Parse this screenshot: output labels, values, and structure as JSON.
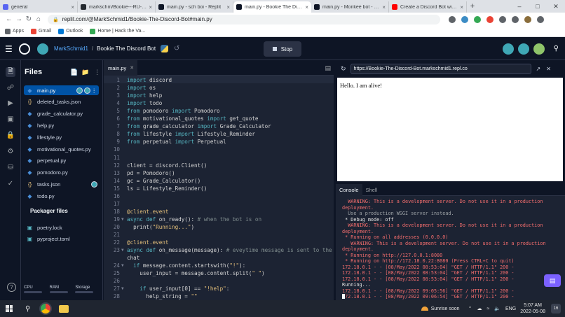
{
  "browser": {
    "tabs": [
      {
        "title": "general",
        "color": "#5865f2"
      },
      {
        "title": "markschm/Bookie---RU-Ha...",
        "color": "#24292f"
      },
      {
        "title": "main.py - sch boi - Replit",
        "color": "#0e1525"
      },
      {
        "title": "main.py - Bookie The Disco...",
        "color": "#0e1525"
      },
      {
        "title": "main.py - Monkee bot - Re...",
        "color": "#0e1525"
      },
      {
        "title": "Create a Discord Bot with Py...",
        "color": "#ff0000"
      }
    ],
    "active_tab": 3,
    "new_tab": "+",
    "url": "replit.com/@MarkSchmid1/Bookie-The-Discord-Bot#main.py",
    "bookmarks": [
      {
        "label": "Apps",
        "color": "#5f6368"
      },
      {
        "label": "Gmail",
        "color": "#ea4335"
      },
      {
        "label": "Outlook",
        "color": "#0078d4"
      },
      {
        "label": "Home | Hack the Va...",
        "color": "#34a853"
      }
    ]
  },
  "header": {
    "username": "MarkSchmid1",
    "separator": "/",
    "repl_name": "Bookie The Discord Bot",
    "stop_label": "Stop"
  },
  "files": {
    "title": "Files",
    "items": [
      {
        "name": "main.py",
        "icon": "python",
        "active": true
      },
      {
        "name": "deleted_tasks.json",
        "icon": "json"
      },
      {
        "name": "grade_calculator.py",
        "icon": "python"
      },
      {
        "name": "help.py",
        "icon": "python"
      },
      {
        "name": "lifestyle.py",
        "icon": "python"
      },
      {
        "name": "motivational_quotes.py",
        "icon": "python"
      },
      {
        "name": "perpetual.py",
        "icon": "python"
      },
      {
        "name": "pomodoro.py",
        "icon": "python"
      },
      {
        "name": "tasks.json",
        "icon": "json"
      },
      {
        "name": "todo.py",
        "icon": "python"
      }
    ],
    "packager_title": "Packager files",
    "packager_items": [
      {
        "name": "poetry.lock",
        "icon": "package"
      },
      {
        "name": "pyproject.toml",
        "icon": "package"
      }
    ],
    "resources": [
      "CPU",
      "RAM",
      "Storage"
    ]
  },
  "editor": {
    "tab": "main.py",
    "lines": [
      {
        "n": "1",
        "code": "import discord"
      },
      {
        "n": "2",
        "code": "import os"
      },
      {
        "n": "3",
        "code": "import help"
      },
      {
        "n": "4",
        "code": "import todo"
      },
      {
        "n": "5",
        "code": "from pomodoro import Pomodoro"
      },
      {
        "n": "6",
        "code": "from motivational_quotes import get_quote"
      },
      {
        "n": "7",
        "code": "from grade_calculator import Grade_Calculator"
      },
      {
        "n": "8",
        "code": "from lifestyle import Lifestyle_Reminder"
      },
      {
        "n": "9",
        "code": "from perpetual import Perpetual"
      },
      {
        "n": "10",
        "code": ""
      },
      {
        "n": "11",
        "code": ""
      },
      {
        "n": "12",
        "code": "client = discord.Client()"
      },
      {
        "n": "13",
        "code": "pd = Pomodoro()"
      },
      {
        "n": "14",
        "code": "gc = Grade_Calculator()"
      },
      {
        "n": "15",
        "code": "ls = Lifestyle_Reminder()"
      },
      {
        "n": "16",
        "code": ""
      },
      {
        "n": "17",
        "code": ""
      },
      {
        "n": "18",
        "code": "@client.event"
      },
      {
        "n": "19",
        "code": "async def on_ready(): # when the bot is on",
        "fold": true
      },
      {
        "n": "20",
        "code": "  print(\"Running...\")"
      },
      {
        "n": "21",
        "code": ""
      },
      {
        "n": "22",
        "code": "@client.event"
      },
      {
        "n": "23",
        "code": "async def on_message(message): # eveytime message is sent to the",
        "fold": true
      },
      {
        "n": "",
        "code": "chat"
      },
      {
        "n": "24",
        "code": "  if message.content.startswith(\"!\"):",
        "fold": true
      },
      {
        "n": "25",
        "code": "    user_input = message.content.split(\" \")"
      },
      {
        "n": "26",
        "code": ""
      },
      {
        "n": "27",
        "code": "    if user_input[0] == \"!help\":",
        "fold": true
      },
      {
        "n": "28",
        "code": "      help_string = \"\""
      }
    ]
  },
  "webview": {
    "url": "https://Bookie-The-Discord-Bot.markschmid1.repl.co",
    "content": "Hello. I am alive!"
  },
  "console": {
    "tabs": [
      "Console",
      "Shell"
    ],
    "lines": [
      {
        "t": "  WARNING: This is a development server. Do not use it in a production deployment.",
        "c": "cr"
      },
      {
        "t": "  Use a production WSGI server instead.",
        "c": "cg"
      },
      {
        "t": " * Debug mode: off",
        "c": "cw"
      },
      {
        "t": "  WARNING: This is a development server. Do not use it in a production deployment.",
        "c": "cr"
      },
      {
        "t": " * Running on all addresses (0.0.0.0)",
        "c": "cr"
      },
      {
        "t": "   WARNING: This is a development server. Do not use it in a production deployment.",
        "c": "cr"
      },
      {
        "t": " * Running on http://127.0.0.1:8080",
        "c": "cr"
      },
      {
        "t": " * Running on http://172.18.0.22:8080 (Press CTRL+C to quit)",
        "c": "cr"
      },
      {
        "t": "172.18.0.1 - - [08/May/2022 08:53:04] \"GET / HTTP/1.1\" 200 -",
        "c": "cr"
      },
      {
        "t": "172.18.0.1 - - [08/May/2022 08:53:04] \"GET / HTTP/1.1\" 200 -",
        "c": "cr"
      },
      {
        "t": "172.18.0.1 - - [08/May/2022 08:53:04] \"GET / HTTP/1.1\" 200 -",
        "c": "cr"
      },
      {
        "t": "Running...",
        "c": "cw"
      },
      {
        "t": "172.18.0.1 - - [08/May/2022 09:05:56] \"GET / HTTP/1.1\" 200 -",
        "c": "cr"
      },
      {
        "t": "172.18.0.1 - - [08/May/2022 09:06:54] \"GET / HTTP/1.1\" 200 -",
        "c": "cr"
      },
      {
        "t": "172.18.0.1 - - [08/May/2022 09:07:52] \"GET / HTTP/1.1\" 200 -",
        "c": "cr"
      }
    ]
  },
  "taskbar": {
    "weather": "Sunrise soon",
    "lang": "ENG",
    "time": "5:07 AM",
    "date": "2022-05-08",
    "notif_count": "16"
  }
}
